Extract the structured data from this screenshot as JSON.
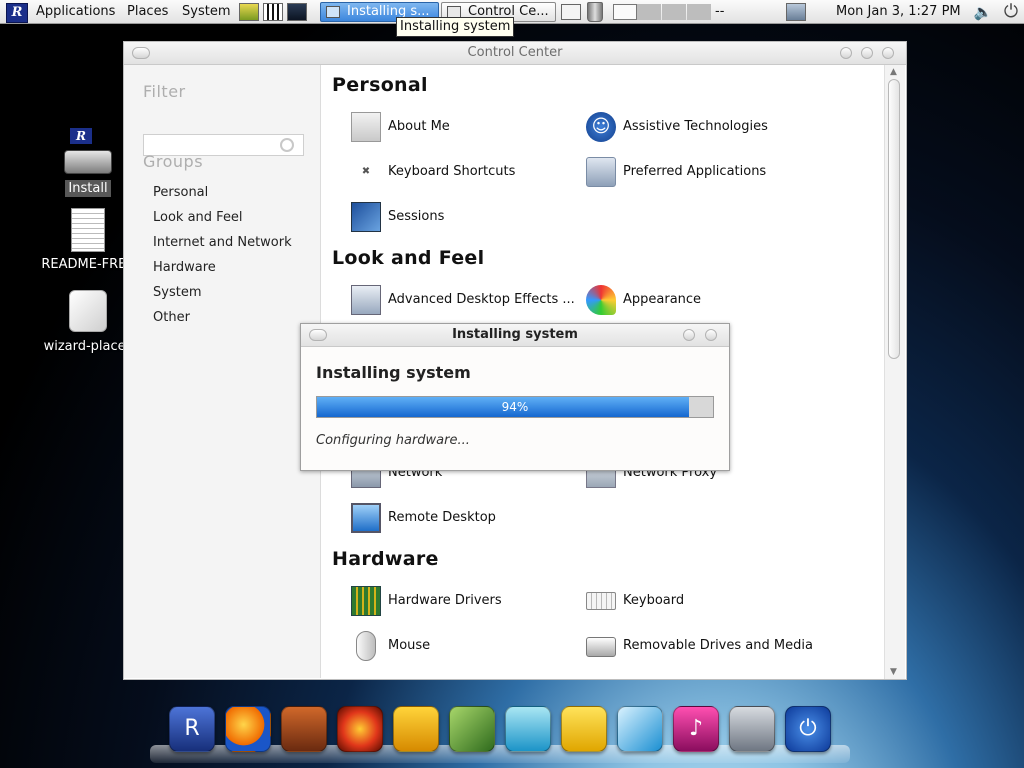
{
  "top_panel": {
    "menus": [
      "Applications",
      "Places",
      "System"
    ],
    "tasks": [
      {
        "label": "Installing s...",
        "active": true
      },
      {
        "label": "Control Ce...",
        "active": false
      }
    ],
    "ws_separator": "--",
    "clock": "Mon Jan  3,  1:27 PM"
  },
  "tooltip": "Installing system",
  "desktop_icons": [
    {
      "label": "Install",
      "icon": "install-icon"
    },
    {
      "label": "README-FREE",
      "icon": "document-icon"
    },
    {
      "label": "wizard-places",
      "icon": "package-icon"
    }
  ],
  "control_center": {
    "title": "Control Center",
    "filter_label": "Filter",
    "filter_value": "",
    "groups_label": "Groups",
    "groups": [
      "Personal",
      "Look and Feel",
      "Internet and Network",
      "Hardware",
      "System",
      "Other"
    ],
    "sections": {
      "personal": {
        "title": "Personal",
        "items": [
          "About Me",
          "Assistive Technologies",
          "Keyboard Shortcuts",
          "Preferred Applications",
          "Sessions"
        ]
      },
      "look": {
        "title": "Look and Feel",
        "items": [
          "Advanced Desktop Effects ...",
          "Appearance"
        ]
      },
      "network": {
        "items": [
          "Network",
          "Network Proxy",
          "Remote Desktop"
        ]
      },
      "hardware": {
        "title": "Hardware",
        "items": [
          "Hardware Drivers",
          "Keyboard",
          "Mouse",
          "Removable Drives and Media"
        ]
      }
    }
  },
  "installer": {
    "title": "Installing system",
    "heading": "Installing system",
    "progress_percent": 94,
    "progress_text": "94%",
    "status": "Configuring hardware..."
  },
  "dock": {
    "icons": [
      "logo-icon",
      "browser-icon",
      "guitar-icon",
      "burner-icon",
      "coffee-icon",
      "photo-icon",
      "messenger-icon",
      "office-icon",
      "graphics-icon",
      "music-icon",
      "settings-icon",
      "power-icon"
    ]
  },
  "colors": {
    "accent": "#1567cf",
    "task_active": "#4a90e2"
  }
}
